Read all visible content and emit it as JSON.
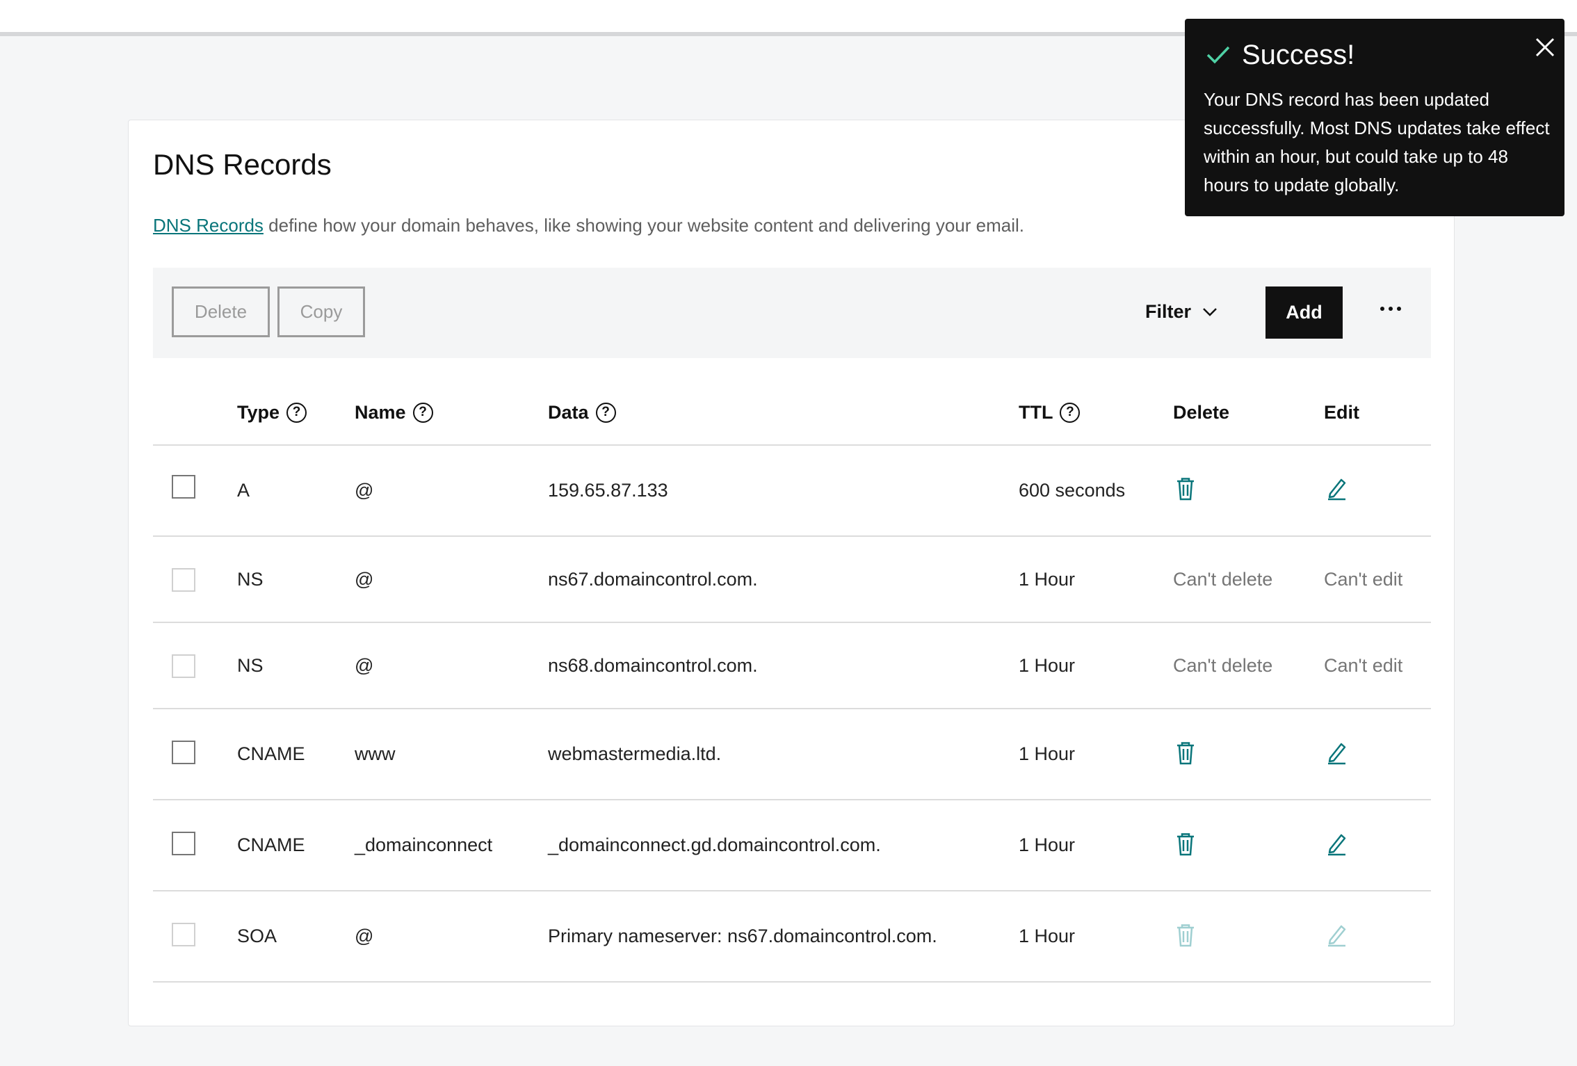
{
  "card": {
    "title": "DNS Records",
    "desc_link": "DNS Records",
    "desc_text": " define how your domain behaves, like showing your website content and delivering your email."
  },
  "toolbar": {
    "delete_label": "Delete",
    "copy_label": "Copy",
    "filter_label": "Filter",
    "add_label": "Add"
  },
  "table": {
    "headers": {
      "type": "Type",
      "name": "Name",
      "data": "Data",
      "ttl": "TTL",
      "delete": "Delete",
      "edit": "Edit"
    },
    "rows": [
      {
        "type": "A",
        "name": "@",
        "data": "159.65.87.133",
        "ttl": "600 seconds",
        "delete": "delete-icon",
        "edit": "edit-icon",
        "checkbox_enabled": true
      },
      {
        "type": "NS",
        "name": "@",
        "data": "ns67.domaincontrol.com.",
        "ttl": "1 Hour",
        "delete": "Can't delete",
        "edit": "Can't edit",
        "checkbox_enabled": false
      },
      {
        "type": "NS",
        "name": "@",
        "data": "ns68.domaincontrol.com.",
        "ttl": "1 Hour",
        "delete": "Can't delete",
        "edit": "Can't edit",
        "checkbox_enabled": false
      },
      {
        "type": "CNAME",
        "name": "www",
        "data": "webmastermedia.ltd.",
        "ttl": "1 Hour",
        "delete": "delete-icon",
        "edit": "edit-icon",
        "checkbox_enabled": true
      },
      {
        "type": "CNAME",
        "name": "_domainconnect",
        "data": "_domainconnect.gd.domaincontrol.com.",
        "ttl": "1 Hour",
        "delete": "delete-icon",
        "edit": "edit-icon",
        "checkbox_enabled": true
      },
      {
        "type": "SOA",
        "name": "@",
        "data": "Primary nameserver: ns67.domaincontrol.com.",
        "ttl": "1 Hour",
        "delete": "delete-icon-disabled",
        "edit": "edit-icon-disabled",
        "checkbox_enabled": false
      }
    ]
  },
  "toast": {
    "title": "Success!",
    "body": "Your DNS record has been updated successfully. Most DNS updates take effect within an hour, but could take up to 48 hours to update globally."
  },
  "colors": {
    "accent": "#09757a",
    "accent_disabled": "#9fcfd1",
    "toast_bg": "#111111",
    "success_check": "#4fd1a5"
  }
}
